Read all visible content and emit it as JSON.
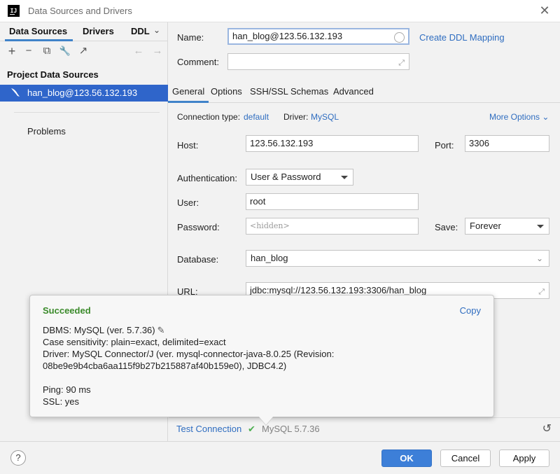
{
  "window": {
    "title": "Data Sources and Drivers",
    "close": "✕"
  },
  "left": {
    "tabs": [
      "Data Sources",
      "Drivers",
      "DDL"
    ],
    "tab_chevron": "⌄",
    "toolbar": {
      "add": "+",
      "remove": "−",
      "copy": "⧉",
      "settings": "🔧",
      "jump": "↗",
      "back": "←",
      "forward": "→"
    },
    "section_title": "Project Data Sources",
    "selected_source": "han_blog@123.56.132.193",
    "problems": "Problems"
  },
  "right": {
    "name_label": "Name:",
    "name_value": "han_blog@123.56.132.193",
    "create_ddl": "Create DDL Mapping",
    "comment_label": "Comment:",
    "comment_value": "",
    "tabs": [
      "General",
      "Options",
      "SSH/SSL",
      "Schemas",
      "Advanced"
    ],
    "conn_type_label": "Connection type:",
    "conn_type_value": "default",
    "driver_label": "Driver:",
    "driver_value": "MySQL",
    "more_options": "More Options ⌄",
    "host_label": "Host:",
    "host_value": "123.56.132.193",
    "port_label": "Port:",
    "port_value": "3306",
    "auth_label": "Authentication:",
    "auth_value": "User & Password",
    "user_label": "User:",
    "user_value": "root",
    "password_label": "Password:",
    "password_placeholder": "<hidden>",
    "save_label": "Save:",
    "save_value": "Forever",
    "database_label": "Database:",
    "database_value": "han_blog",
    "url_label": "URL:",
    "url_value": "jdbc:mysql://123.56.132.193:3306/han_blog"
  },
  "popup": {
    "status": "Succeeded",
    "copy": "Copy",
    "dbms": "DBMS: MySQL (ver. 5.7.36)",
    "case": "Case sensitivity: plain=exact, delimited=exact",
    "driver1": "Driver: MySQL Connector/J (ver. mysql-connector-java-8.0.25 (Revision:",
    "driver2": "08be9e9b4cba6aa115f9b27b215887af40b159e0), JDBC4.2)",
    "ping": "Ping: 90 ms",
    "ssl": "SSL: yes"
  },
  "status_bar": {
    "test_connection": "Test Connection",
    "check": "✔",
    "version": "MySQL 5.7.36",
    "undo": "↺"
  },
  "footer": {
    "help": "?",
    "ok": "OK",
    "cancel": "Cancel",
    "apply": "Apply"
  }
}
